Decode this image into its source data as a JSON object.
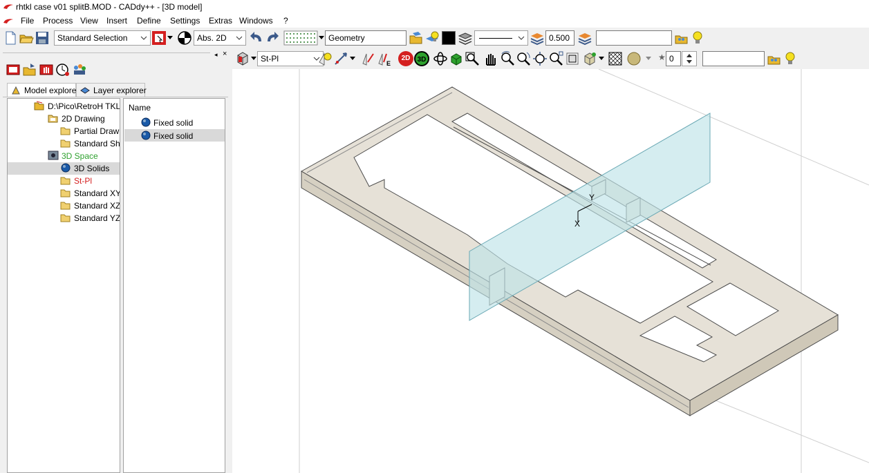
{
  "window": {
    "title": "rhtkl case v01 splitB.MOD  -  CADdy++  - [3D model]"
  },
  "menu": {
    "items": [
      "File",
      "Process",
      "View",
      "Insert",
      "Define",
      "Settings",
      "Extras",
      "Windows",
      "?"
    ]
  },
  "toolbar1": {
    "selection_mode": "Standard Selection",
    "coord_mode": "Abs. 2D",
    "layer_name": "Geometry",
    "line_width": "0.500",
    "extra_field": ""
  },
  "toolbar2": {
    "plane": "St-Pl",
    "view_2d_label": "2D",
    "view_3d_label": "3D",
    "counter_value": "0",
    "extra_field": ""
  },
  "explorer": {
    "tabs": [
      {
        "label": "Model explorer",
        "active": true
      },
      {
        "label": "Layer explorer",
        "active": false
      }
    ],
    "tree": [
      {
        "label": "D:\\Pico\\RetroH TKL",
        "color": "#000000",
        "indent": 0,
        "icon": "folder-open-icon"
      },
      {
        "label": "2D Drawing",
        "color": "#000000",
        "indent": 1,
        "icon": "drawing-icon"
      },
      {
        "label": "Partial Draw",
        "color": "#000000",
        "indent": 2,
        "icon": "folder-icon"
      },
      {
        "label": "Standard Sh",
        "color": "#000000",
        "indent": 2,
        "icon": "folder-icon"
      },
      {
        "label": "3D Space",
        "color": "#2ea12e",
        "indent": 1,
        "icon": "space-icon"
      },
      {
        "label": "3D Solids",
        "color": "#000000",
        "indent": 2,
        "icon": "solid-sphere-icon",
        "selected": true
      },
      {
        "label": "St-Pl",
        "color": "#d42020",
        "indent": 2,
        "icon": "folder-icon"
      },
      {
        "label": "Standard XY",
        "color": "#000000",
        "indent": 2,
        "icon": "folder-icon"
      },
      {
        "label": "Standard XZ",
        "color": "#000000",
        "indent": 2,
        "icon": "folder-icon"
      },
      {
        "label": "Standard YZ",
        "color": "#000000",
        "indent": 2,
        "icon": "folder-icon"
      }
    ],
    "list": {
      "header": "Name",
      "rows": [
        {
          "label": "Fixed solid",
          "selected": false
        },
        {
          "label": "Fixed solid",
          "selected": true
        }
      ]
    }
  },
  "viewport": {
    "axis_labels": {
      "y": "Y",
      "x": "X"
    }
  },
  "colors": {
    "solid_fill": "#e6e1d7",
    "solid_edge": "#4a4a4a",
    "plane_fill": "#bfe3e8",
    "accent_red": "#d42020"
  }
}
